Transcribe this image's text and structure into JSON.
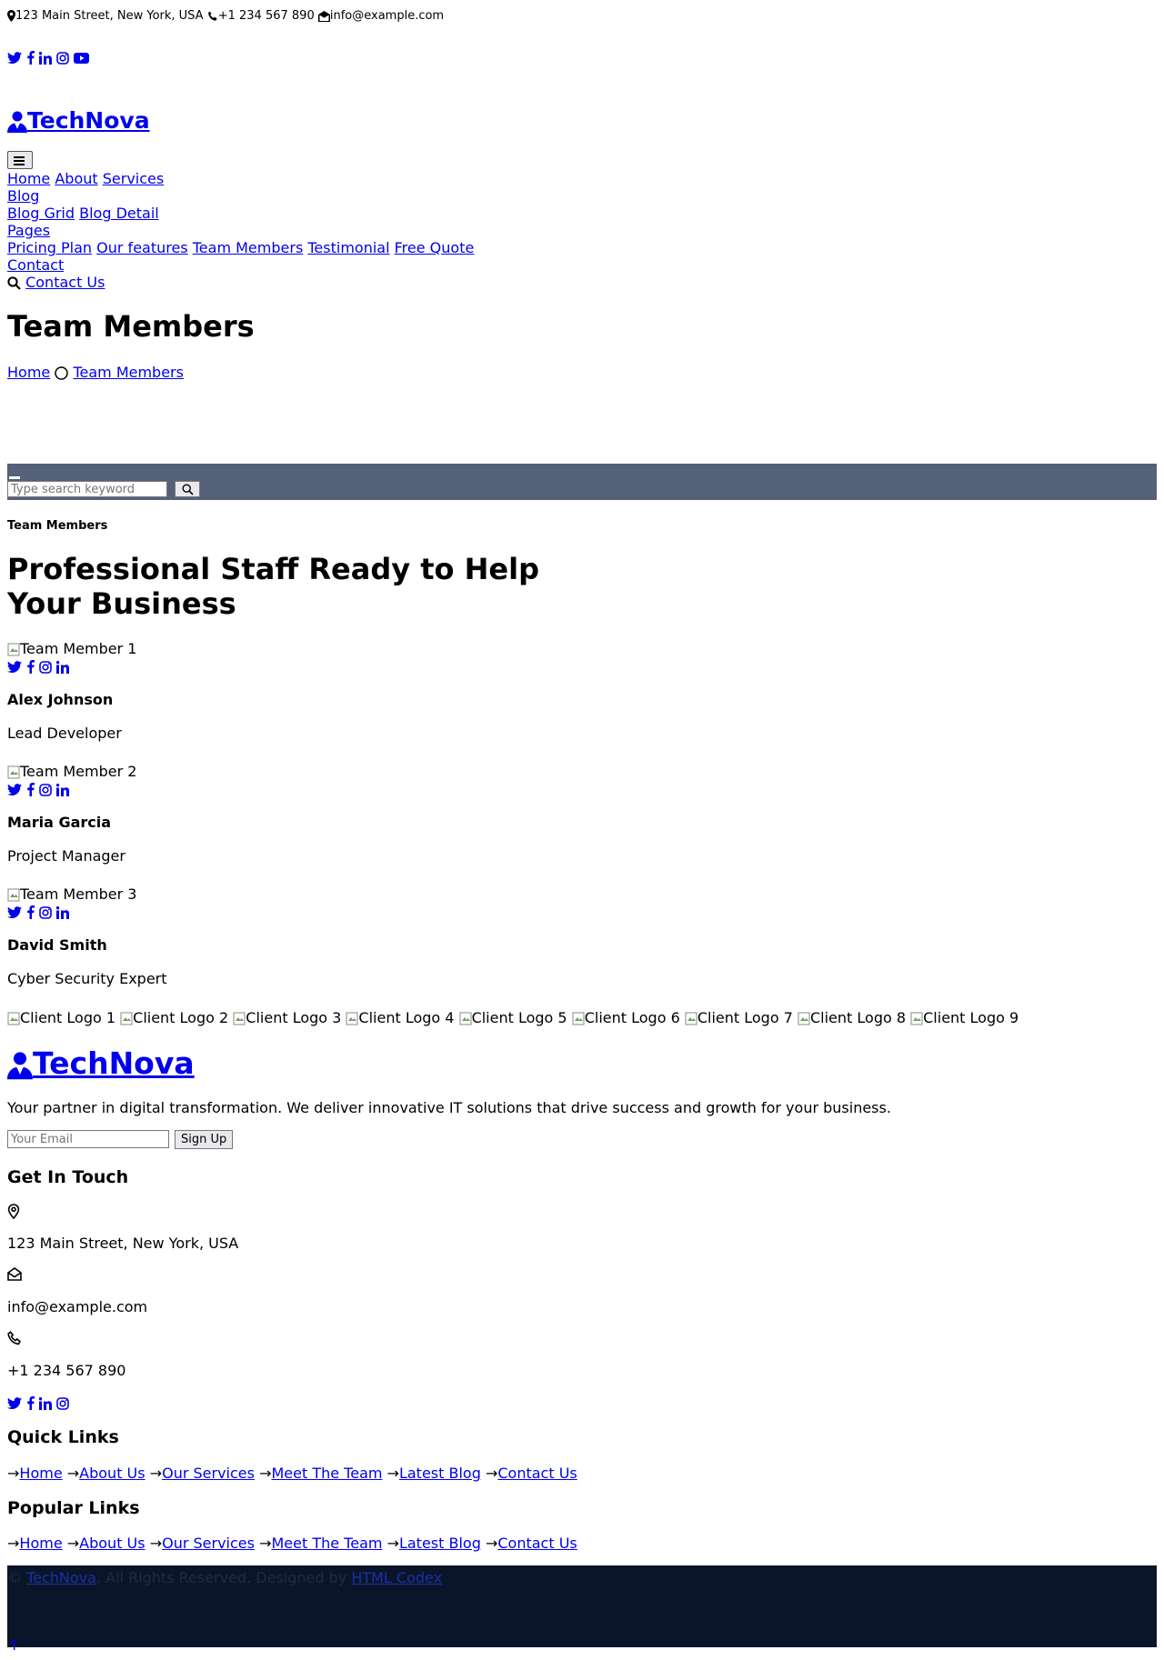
{
  "topbar": {
    "address": "123 Main Street, New York, USA",
    "phone": "+1 234 567 890",
    "email": "info@example.com",
    "social_icons": [
      "twitter-icon",
      "facebook-icon",
      "linkedin-icon",
      "instagram-icon",
      "youtube-icon"
    ]
  },
  "brand": {
    "name": "TechNova"
  },
  "nav": {
    "items": [
      "Home",
      "About",
      "Services"
    ],
    "blog": "Blog",
    "blog_sub": [
      "Blog Grid",
      "Blog Detail"
    ],
    "pages": "Pages",
    "pages_sub": [
      "Pricing Plan",
      "Our features",
      "Team Members",
      "Testimonial",
      "Free Quote"
    ],
    "contact": "Contact",
    "cta": "Contact Us"
  },
  "hero": {
    "title": "Team Members",
    "breadcrumb": [
      "Home",
      "Team Members"
    ]
  },
  "search": {
    "placeholder": "Type search keyword"
  },
  "team": {
    "eyebrow": "Team Members",
    "heading_line1": "Professional Staff Ready to Help",
    "heading_line2": "Your Business",
    "members": [
      {
        "img_alt": "Team Member 1",
        "name": "Alex Johnson",
        "role": "Lead Developer"
      },
      {
        "img_alt": "Team Member 2",
        "name": "Maria Garcia",
        "role": "Project Manager"
      },
      {
        "img_alt": "Team Member 3",
        "name": "David Smith",
        "role": "Cyber Security Expert"
      }
    ]
  },
  "clients": [
    "Client Logo 1",
    "Client Logo 2",
    "Client Logo 3",
    "Client Logo 4",
    "Client Logo 5",
    "Client Logo 6",
    "Client Logo 7",
    "Client Logo 8",
    "Client Logo 9"
  ],
  "footer": {
    "brand": "TechNova",
    "about": "Your partner in digital transformation. We deliver innovative IT solutions that drive success and growth for your business.",
    "email_placeholder": "Your Email",
    "signup": "Sign Up",
    "get_in_touch": "Get In Touch",
    "address": "123 Main Street, New York, USA",
    "email": "info@example.com",
    "phone": "+1 234 567 890",
    "quick_links_title": "Quick Links",
    "quick_links": [
      "Home",
      "About Us",
      "Our Services",
      "Meet The Team",
      "Latest Blog",
      "Contact Us"
    ],
    "popular_links_title": "Popular Links",
    "popular_links": [
      "Home",
      "About Us",
      "Our Services",
      "Meet The Team",
      "Latest Blog",
      "Contact Us"
    ],
    "copyright_prefix": "©",
    "copyright_brand": "TechNova",
    "copyright_mid": ". All Rights Reserved. Designed by",
    "copyright_designer": "HTML Codex",
    "back_to_top": "↑"
  }
}
